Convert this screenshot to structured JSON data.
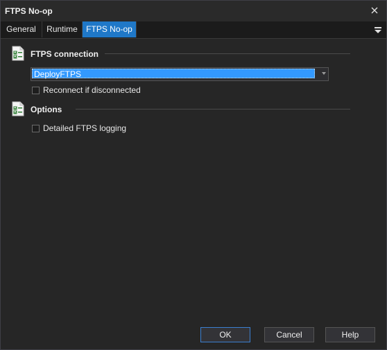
{
  "window": {
    "title": "FTPS No-op"
  },
  "tabs": [
    {
      "label": "General",
      "active": false
    },
    {
      "label": "Runtime",
      "active": false
    },
    {
      "label": "FTPS No-op",
      "active": true
    }
  ],
  "sections": {
    "connection": {
      "title": "FTPS connection",
      "connection_value": "DeployFTPS",
      "reconnect_label": "Reconnect if disconnected",
      "reconnect_checked": false
    },
    "options": {
      "title": "Options",
      "logging_label": "Detailed FTPS logging",
      "logging_checked": false
    }
  },
  "buttons": {
    "ok": "OK",
    "cancel": "Cancel",
    "help": "Help"
  },
  "colors": {
    "accent": "#1f78c8",
    "selection": "#3399ff",
    "background": "#262626"
  },
  "icons": {
    "close": "close-icon",
    "tab_menu": "tab-menu-icon",
    "section": "checklist-icon"
  }
}
